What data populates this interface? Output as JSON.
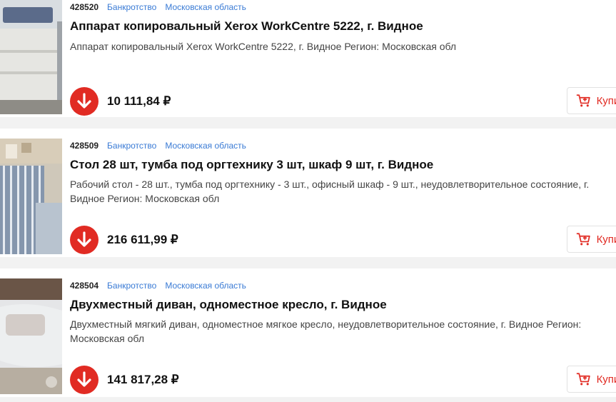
{
  "lots": [
    {
      "id": "428520",
      "category": "Банкротство",
      "region": "Московская область",
      "title": "Аппарат копировальный Xerox WorkCentre 5222, г. Видное",
      "description": [
        "Аппарат копировальный Xerox WorkCentre 5222, г. Видное Регион: Московская обл"
      ],
      "price": "10 111,84 ₽",
      "buy_label": "Купить",
      "image": "copier-photo"
    },
    {
      "id": "428509",
      "category": "Банкротство",
      "region": "Московская область",
      "title": "Стол 28 шт, тумба под оргтехнику 3 шт, шкаф 9 шт, г. Видное",
      "description": [
        "Рабочий стол - 28 шт., тумба под оргтехнику - 3 шт., офисный шкаф - 9 шт., неудовлетворительное состояние, г.",
        "Видное Регион: Московская обл"
      ],
      "price": "216 611,99 ₽",
      "buy_label": "Купить",
      "image": "office-furniture-photo"
    },
    {
      "id": "428504",
      "category": "Банкротство",
      "region": "Московская область",
      "title": "Двухместный диван, одноместное кресло, г. Видное",
      "description": [
        "Двухместный мягкий диван, одноместное мягкое кресло, неудовлетворительное состояние, г. Видное Регион:",
        "Московская обл"
      ],
      "price": "141 817,28 ₽",
      "buy_label": "Купить",
      "image": "sofa-photo"
    }
  ],
  "colors": {
    "accent": "#e12b23",
    "link": "#3a7bd5"
  },
  "icons": {
    "price_down": "arrow-down-icon",
    "buy": "cart-plus-icon"
  }
}
